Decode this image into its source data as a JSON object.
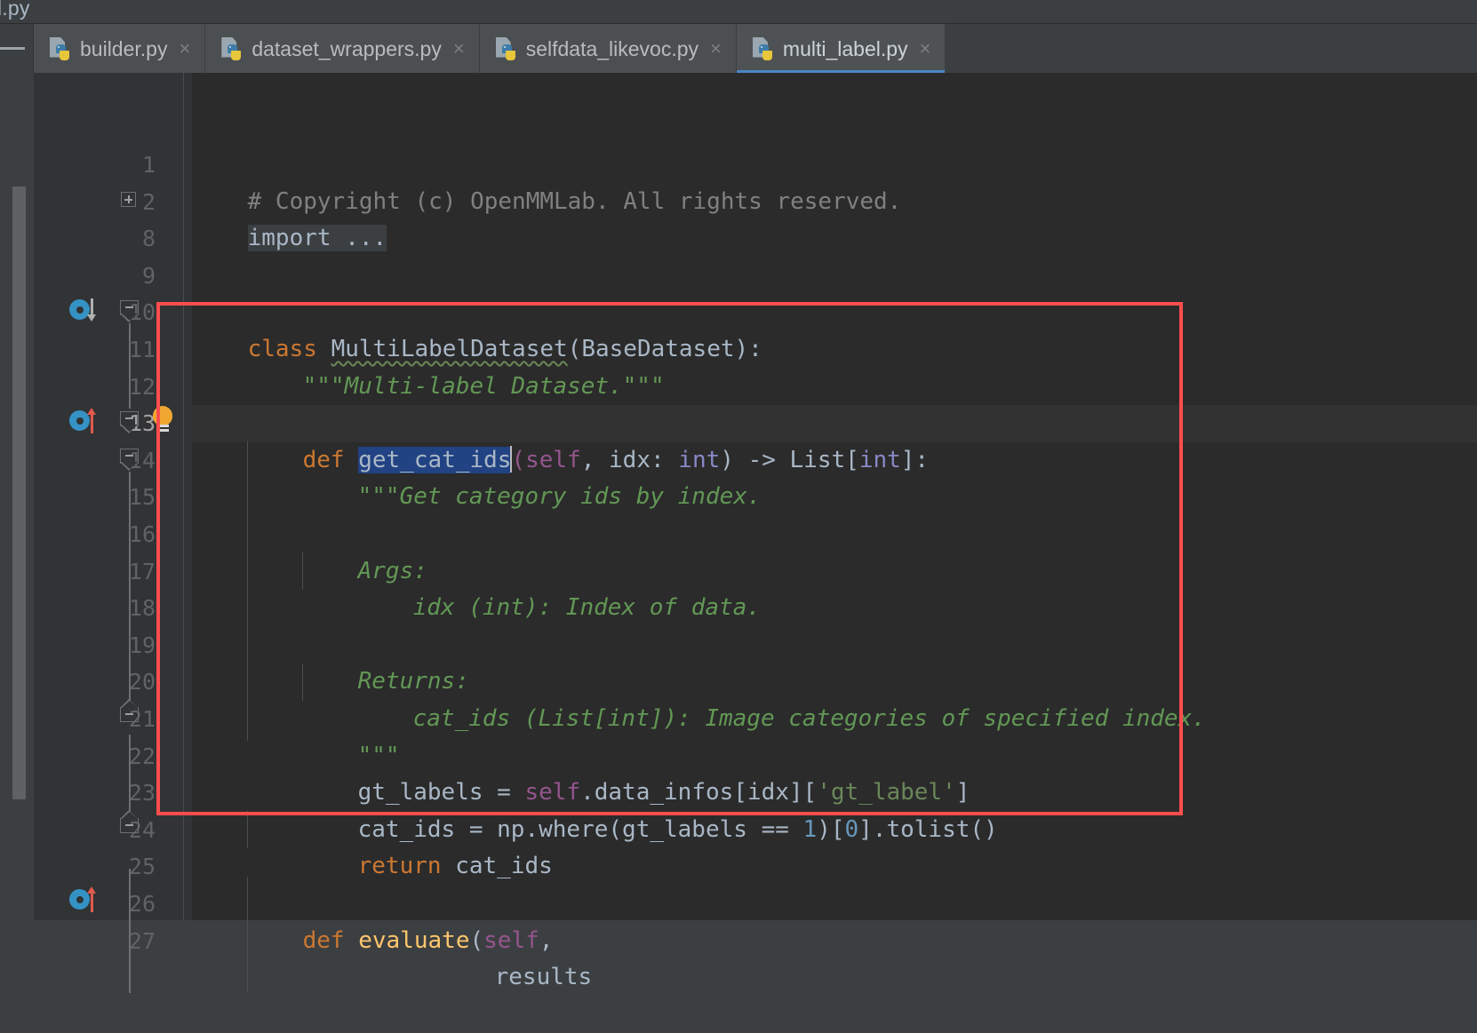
{
  "window": {
    "breadcrumb_partial": "el.py",
    "theme": "darcula"
  },
  "tabbar": {
    "tabs": [
      {
        "label": "builder.py",
        "icon": "python-file-icon",
        "close": "×",
        "active": false
      },
      {
        "label": "dataset_wrappers.py",
        "icon": "python-file-icon",
        "close": "×",
        "active": false
      },
      {
        "label": "selfdata_likevoc.py",
        "icon": "python-file-icon",
        "close": "×",
        "active": false
      },
      {
        "label": "multi_label.py",
        "icon": "python-file-icon",
        "close": "×",
        "active": true
      }
    ]
  },
  "editor": {
    "active_file": "multi_label.py",
    "caret_line": 13,
    "selected_text": "get_cat_ids",
    "colors": {
      "background": "#2b2b2b",
      "gutter": "#313335",
      "current_line": "#323232",
      "keyword": "#cc7832",
      "function": "#ffc66d",
      "self": "#94558d",
      "number": "#6897bb",
      "string": "#6a8759",
      "docstring": "#629755",
      "comment": "#808080",
      "type": "#8888c6",
      "default_text": "#a9b7c6",
      "selection": "#214283",
      "annotation": "#ff4d4d",
      "tab_active_underline": "#4a88c7"
    },
    "line_numbers": [
      "1",
      "2",
      "8",
      "9",
      "10",
      "11",
      "12",
      "13",
      "14",
      "15",
      "16",
      "17",
      "18",
      "19",
      "20",
      "21",
      "22",
      "23",
      "24",
      "25",
      "26",
      "27"
    ],
    "lines": [
      {
        "num": "1",
        "text": "# Copyright (c) OpenMMLab. All rights reserved."
      },
      {
        "num": "2",
        "text": "import ..."
      },
      {
        "num": "8",
        "text": ""
      },
      {
        "num": "9",
        "text": ""
      },
      {
        "num": "10",
        "text": "class MultiLabelDataset(BaseDataset):"
      },
      {
        "num": "11",
        "text": "    \"\"\"Multi-label Dataset.\"\"\""
      },
      {
        "num": "12",
        "text": ""
      },
      {
        "num": "13",
        "text": "    def get_cat_ids(self, idx: int) -> List[int]:"
      },
      {
        "num": "14",
        "text": "        \"\"\"Get category ids by index."
      },
      {
        "num": "15",
        "text": ""
      },
      {
        "num": "16",
        "text": "        Args:"
      },
      {
        "num": "17",
        "text": "            idx (int): Index of data."
      },
      {
        "num": "18",
        "text": ""
      },
      {
        "num": "19",
        "text": "        Returns:"
      },
      {
        "num": "20",
        "text": "            cat_ids (List[int]): Image categories of specified index."
      },
      {
        "num": "21",
        "text": "        \"\"\""
      },
      {
        "num": "22",
        "text": "        gt_labels = self.data_infos[idx]['gt_label']"
      },
      {
        "num": "23",
        "text": "        cat_ids = np.where(gt_labels == 1)[0].tolist()"
      },
      {
        "num": "24",
        "text": "        return cat_ids"
      },
      {
        "num": "25",
        "text": ""
      },
      {
        "num": "26",
        "text": "    def evaluate(self,"
      },
      {
        "num": "27",
        "text": "                 results"
      }
    ],
    "gutter_markers": [
      {
        "line": "10",
        "type": "implemented-method-icon"
      },
      {
        "line": "13",
        "type": "overriding-method-icon"
      },
      {
        "line": "26",
        "type": "overriding-method-icon"
      }
    ],
    "intention_bulb": {
      "line": "13",
      "icon": "lightbulb-icon"
    },
    "fold_markers": [
      {
        "line": "2",
        "type": "fold-expand-icon"
      },
      {
        "line": "10",
        "type": "fold-collapse-icon"
      },
      {
        "line": "13",
        "type": "fold-collapse-icon"
      },
      {
        "line": "14",
        "type": "fold-collapse-icon"
      },
      {
        "line": "21",
        "type": "fold-end-icon"
      },
      {
        "line": "24",
        "type": "fold-end-icon"
      }
    ]
  },
  "tokens": {
    "l1_comment": "# Copyright (c) OpenMMLab. All rights reserved.",
    "l2_import": "import ...",
    "l10_kw": "class",
    "l10_name": "MultiLabelDataset",
    "l10_base": "(BaseDataset):",
    "l11_doc": "\"\"\"Multi-label Dataset.\"\"\"",
    "l13_kw": "def",
    "l13_name": "get_cat_ids",
    "l13_open": "(",
    "l13_self": "self",
    "l13_comma": ", idx: ",
    "l13_int": "int",
    "l13_close": ") -> List[",
    "l13_int2": "int",
    "l13_tail": "]:",
    "l14_doc": "\"\"\"Get category ids by index.",
    "l16_doc": "Args:",
    "l17_doc": "idx (int): Index of data.",
    "l19_doc": "Returns:",
    "l20_doc": "cat_ids (List[int]): Image categories of specified index.",
    "l21_doc": "\"\"\"",
    "l22_a": "gt_labels = ",
    "l22_self": "self",
    "l22_b": ".data_infos[idx][",
    "l22_str": "'gt_label'",
    "l22_c": "]",
    "l23_a": "cat_ids = np.where(gt_labels == ",
    "l23_num": "1",
    "l23_b": ")[",
    "l23_num2": "0",
    "l23_c": "].tolist()",
    "l24_kw": "return",
    "l24_name": " cat_ids",
    "l26_kw": "def",
    "l26_fn": " evaluate",
    "l26_open": "(",
    "l26_self": "self",
    "l26_comma": ",",
    "l27_arg": "results"
  }
}
